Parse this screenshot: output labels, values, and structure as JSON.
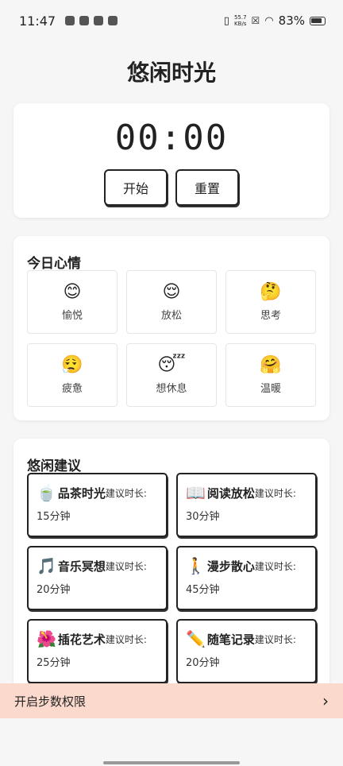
{
  "status_bar": {
    "time": "11:47",
    "net_speed_value": "55.7",
    "net_speed_unit": "KB/s",
    "battery": "83%"
  },
  "header": {
    "title": "悠闲时光"
  },
  "timer": {
    "display": "00:00",
    "start_label": "开始",
    "reset_label": "重置"
  },
  "mood": {
    "section_title": "今日心情",
    "items": [
      {
        "emoji": "😊",
        "label": "愉悦"
      },
      {
        "emoji": "😌",
        "label": "放松"
      },
      {
        "emoji": "🤔",
        "label": "思考"
      },
      {
        "emoji": "😮‍💨",
        "label": "疲惫"
      },
      {
        "emoji": "😴",
        "label": "想休息"
      },
      {
        "emoji": "🤗",
        "label": "温暖"
      }
    ]
  },
  "advice": {
    "section_title": "悠闲建议",
    "duration_label": "建议时长:",
    "items": [
      {
        "icon": "🍵",
        "name": "品茶时光",
        "duration": "15分钟"
      },
      {
        "icon": "📖",
        "name": "阅读放松",
        "duration": "30分钟"
      },
      {
        "icon": "🎵",
        "name": "音乐冥想",
        "duration": "20分钟"
      },
      {
        "icon": "🚶",
        "name": "漫步散心",
        "duration": "45分钟"
      },
      {
        "icon": "🌺",
        "name": "插花艺术",
        "duration": "25分钟"
      },
      {
        "icon": "✏️",
        "name": "随笔记录",
        "duration": "20分钟"
      }
    ]
  },
  "permission_bar": {
    "label": "开启步数权限"
  }
}
